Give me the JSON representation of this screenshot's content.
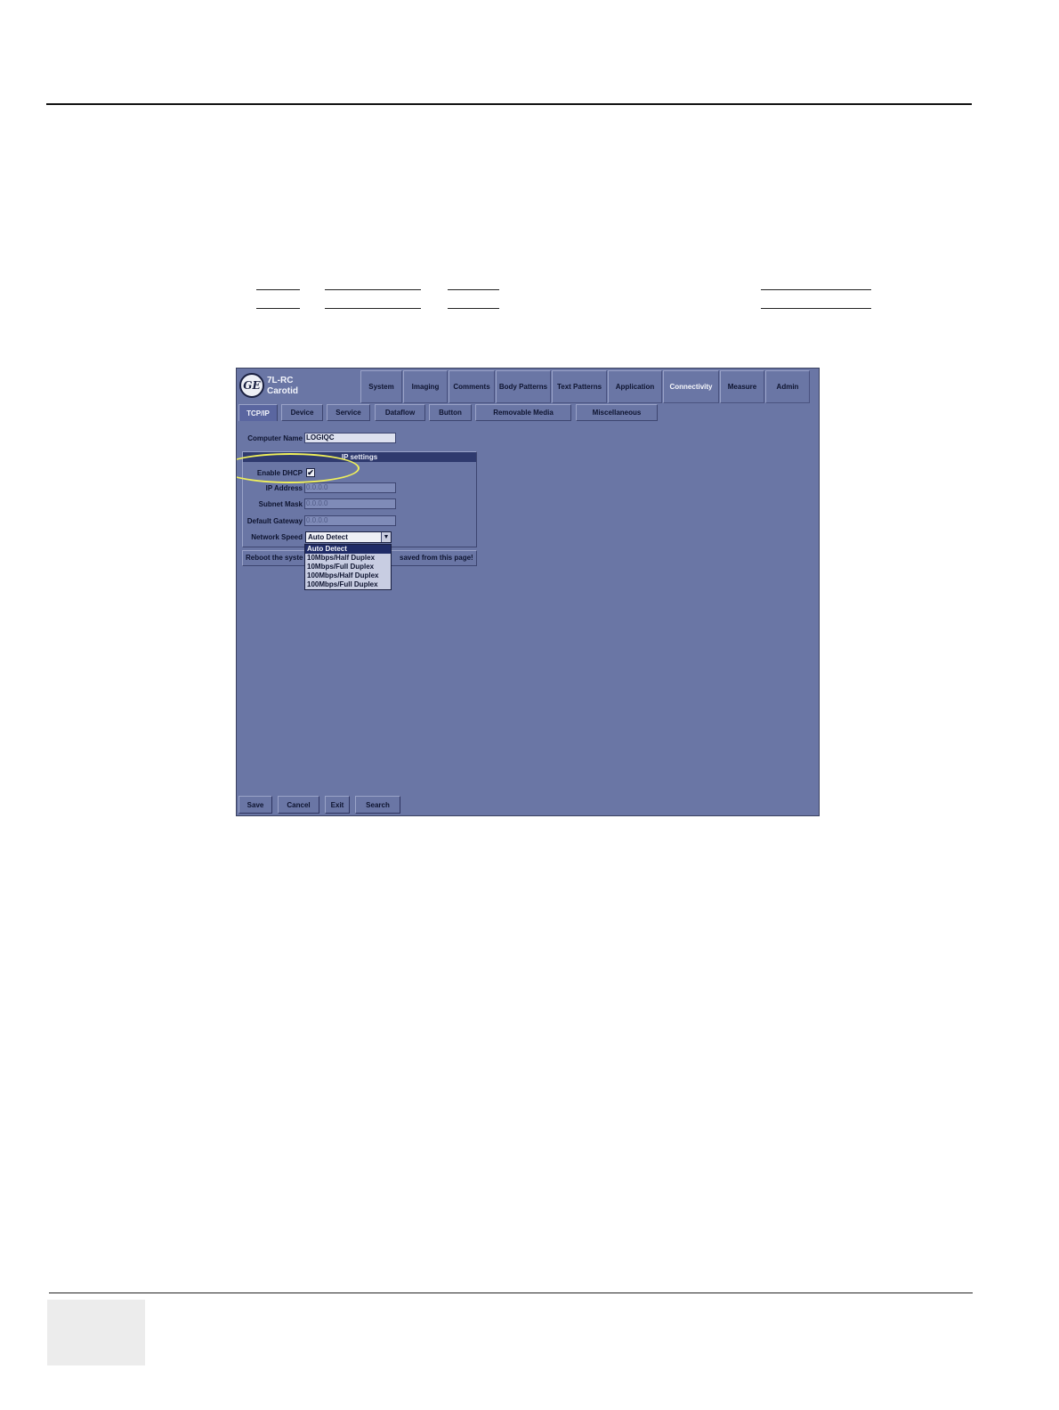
{
  "app": {
    "logo_text": "GE",
    "probe": "7L-RC",
    "preset": "Carotid"
  },
  "main_tabs": [
    {
      "label": "System"
    },
    {
      "label": "Imaging"
    },
    {
      "label": "Comments"
    },
    {
      "label": "Body Patterns"
    },
    {
      "label": "Text Patterns"
    },
    {
      "label": "Application"
    },
    {
      "label": "Connectivity"
    },
    {
      "label": "Measure"
    },
    {
      "label": "Admin"
    }
  ],
  "active_main_tab": "Connectivity",
  "sub_tabs": [
    {
      "label": "TCP/IP"
    },
    {
      "label": "Device"
    },
    {
      "label": "Service"
    },
    {
      "label": "Dataflow"
    },
    {
      "label": "Button"
    },
    {
      "label": "Removable Media"
    },
    {
      "label": "Miscellaneous"
    }
  ],
  "active_sub_tab": "TCP/IP",
  "form": {
    "computer_name_label": "Computer Name",
    "computer_name_value": "LOGIQC",
    "group_title": "IP settings",
    "enable_dhcp_label": "Enable DHCP",
    "enable_dhcp_checked": true,
    "enable_dhcp_mark": "✔",
    "ip_address_label": "IP Address",
    "ip_address_value": "0.0.0.0",
    "subnet_mask_label": "Subnet Mask",
    "subnet_mask_value": "0.0.0.0",
    "default_gateway_label": "Default Gateway",
    "default_gateway_value": "0.0.0.0",
    "network_speed_label": "Network Speed",
    "network_speed_value": "Auto Detect",
    "network_speed_arrow": "▼",
    "network_speed_options": [
      "Auto Detect",
      "10Mbps/Half Duplex",
      "10Mbps/Full Duplex",
      "100Mbps/Half Duplex",
      "100Mbps/Full Duplex"
    ],
    "message_left": "Reboot the syste",
    "message_right": "saved from this page!"
  },
  "buttons": {
    "save": "Save",
    "cancel": "Cancel",
    "exit": "Exit",
    "search": "Search"
  },
  "colors": {
    "screen_bg": "#6a76a5",
    "highlight_ellipse": "#f0f05a",
    "selected_option": "#1f2b66"
  }
}
